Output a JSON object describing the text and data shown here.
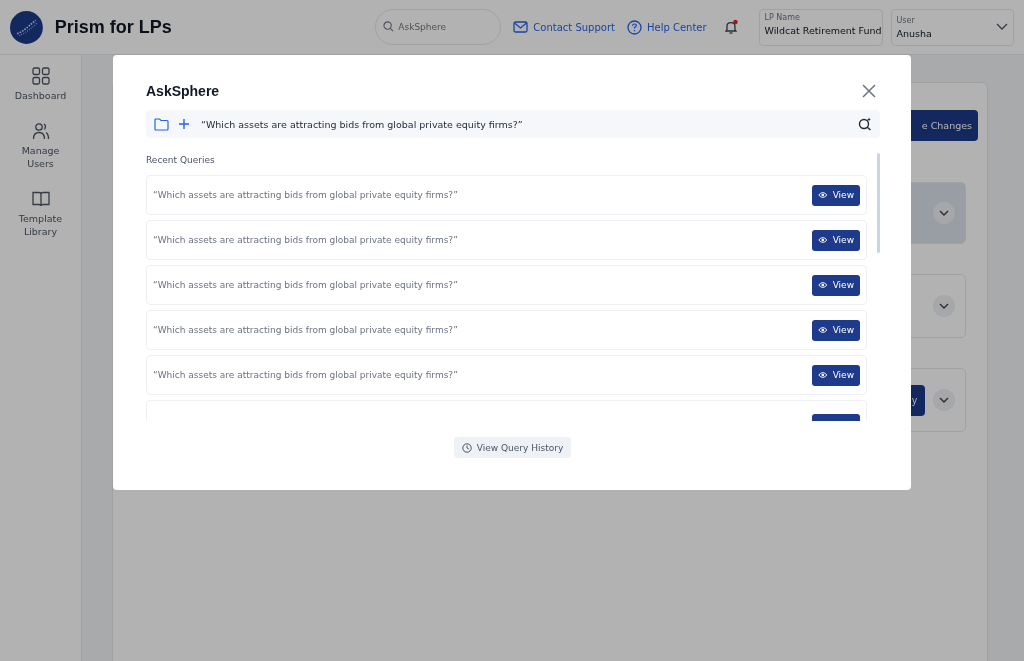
{
  "header": {
    "app_title": "Prism for LPs",
    "search": {
      "placeholder": "AskSphere"
    },
    "links": [
      {
        "label": "Contact Support",
        "kind": "mail"
      },
      {
        "label": "Help Center",
        "kind": "help"
      }
    ],
    "notifications": {
      "unread": true
    },
    "lp_name": {
      "label": "LP Name",
      "value": "Wildcat Retirement Fund"
    },
    "user": {
      "label": "User",
      "value": "Anusha"
    }
  },
  "sidebar": {
    "items": [
      {
        "label": "Dashboard",
        "kind": "grid"
      },
      {
        "label": "Manage Users",
        "kind": "users"
      },
      {
        "label": "Template Library",
        "kind": "book"
      }
    ]
  },
  "background": {
    "save_button": "e Changes",
    "panels": [
      {
        "kind": "highlighted"
      },
      {
        "kind": "plain"
      },
      {
        "kind": "button",
        "button": "y"
      }
    ]
  },
  "modal": {
    "title": "AskSphere",
    "query": {
      "value": "“Which assets are attracting bids from global private equity firms?”"
    },
    "recent_label": "Recent Queries",
    "queries": [
      {
        "text": "“Which assets are attracting bids from global private equity firms?”",
        "button": "View"
      },
      {
        "text": "“Which assets are attracting bids from global private equity firms?”",
        "button": "View"
      },
      {
        "text": "“Which assets are attracting bids from global private equity firms?”",
        "button": "View"
      },
      {
        "text": "“Which assets are attracting bids from global private equity firms?”",
        "button": "View"
      },
      {
        "text": "“Which assets are attracting bids from global private equity firms?”",
        "button": "View"
      },
      {
        "kind": "cut"
      }
    ],
    "history_button": "View Query History"
  }
}
